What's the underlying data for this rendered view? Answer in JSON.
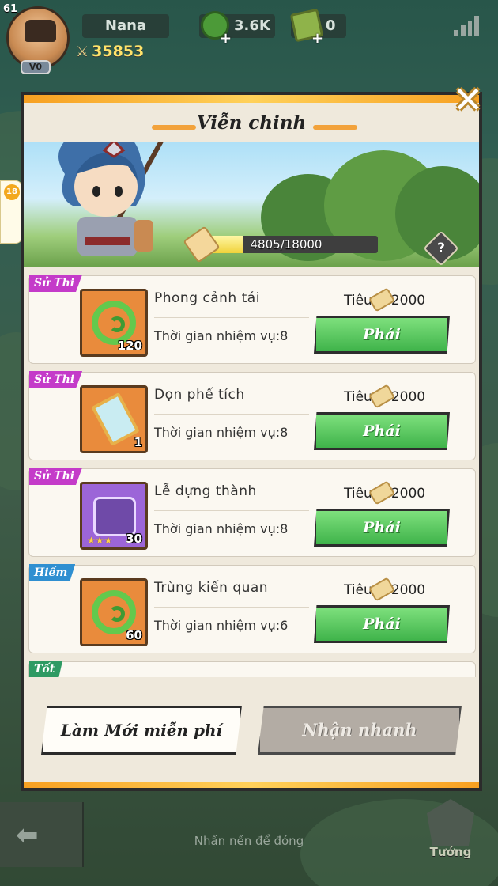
{
  "hud": {
    "avatar_level": "61",
    "vip": "V0",
    "player_name": "Nana",
    "power": "35853",
    "resources": [
      {
        "icon": "jade-coin-icon",
        "value": "3.6K"
      },
      {
        "icon": "scroll-ticket-icon",
        "value": "0"
      }
    ]
  },
  "side_badge": {
    "age": "18"
  },
  "modal": {
    "title": "Viễn chinh",
    "progress": {
      "current": 4805,
      "max": 18000,
      "text": "4805/18000"
    },
    "help_label": "?",
    "missions": [
      {
        "rarity": "Sử Thi",
        "rarity_class": "epic",
        "item_icon": "jade-emblem-icon",
        "qty": "120",
        "name": "Phong cảnh tái",
        "time": "Thời gian nhiệm vụ:8",
        "cost_label": "Tiêu",
        "cost_value": "2000",
        "button": "Phái"
      },
      {
        "rarity": "Sử Thi",
        "rarity_class": "epic",
        "item_icon": "scroll-map-icon",
        "qty": "1",
        "name": "Dọn phế tích",
        "time": "Thời gian nhiệm vụ:8",
        "cost_label": "Tiêu",
        "cost_value": "2000",
        "button": "Phái"
      },
      {
        "rarity": "Sử Thi",
        "rarity_class": "epic",
        "item_icon": "puzzle-piece-icon",
        "qty": "30",
        "stars": "★★★",
        "name": "Lễ dựng thành",
        "time": "Thời gian nhiệm vụ:8",
        "cost_label": "Tiêu",
        "cost_value": "2000",
        "button": "Phái"
      },
      {
        "rarity": "Hiếm",
        "rarity_class": "rare",
        "item_icon": "jade-emblem-icon",
        "qty": "60",
        "name": "Trùng kiến quan",
        "time": "Thời gian nhiệm vụ:6",
        "cost_label": "Tiêu",
        "cost_value": "2000",
        "button": "Phái"
      },
      {
        "rarity": "Tốt",
        "rarity_class": "good",
        "item_icon": "",
        "qty": "",
        "name": "",
        "time": "",
        "cost_label": "",
        "cost_value": "",
        "button": ""
      }
    ],
    "refresh_button": "Làm Mới miễn phí",
    "quick_button": "Nhận nhanh"
  },
  "footer": {
    "tap_hint": "Nhấn nền để đóng",
    "hero_tab": "Tướng"
  },
  "colors": {
    "accent_orange": "#f7a021",
    "epic": "#c43bc9",
    "rare": "#2f8fd1",
    "good": "#2e9a63",
    "dispatch_green": "#3fb34a"
  }
}
